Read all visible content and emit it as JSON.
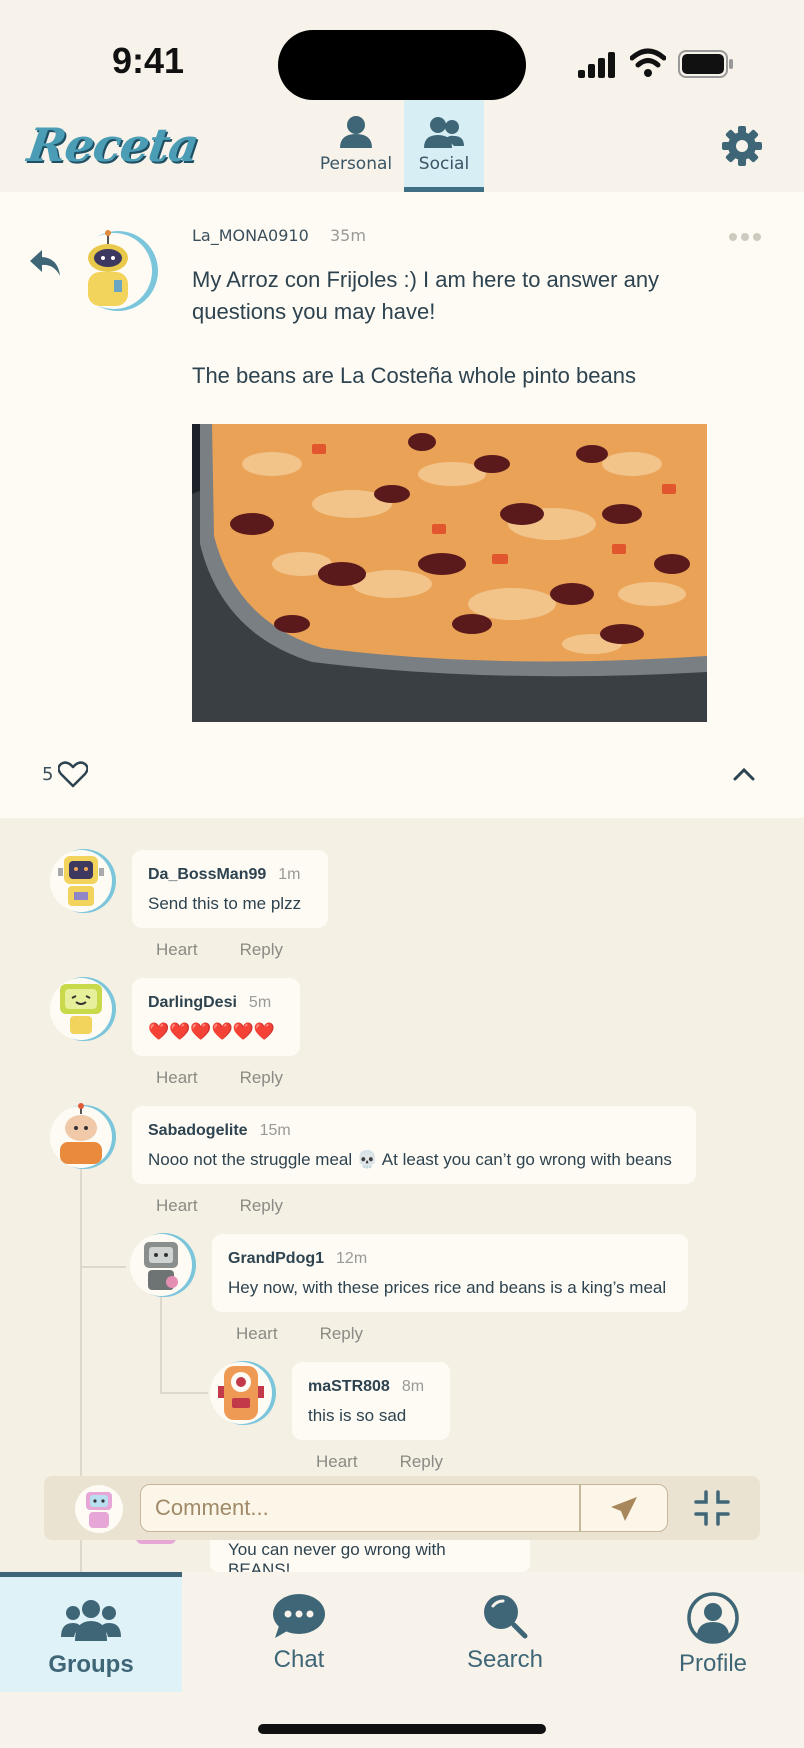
{
  "status_bar": {
    "time": "9:41"
  },
  "header": {
    "logo": "Receta",
    "tabs": [
      {
        "label": "Personal",
        "active": false
      },
      {
        "label": "Social",
        "active": true
      }
    ],
    "settings_icon": "gear-icon"
  },
  "post": {
    "username": "La_MONA0910",
    "time": "35m",
    "text": "My Arroz con Frijoles :) I am here to answer any questions you may have!",
    "text2": "The beans are La Costeña whole pinto beans",
    "likes": "5",
    "photo_alt": "rice and beans in a pan"
  },
  "comments": [
    {
      "username": "Da_BossMan99",
      "time": "1m",
      "text": "Send this to me plzz",
      "heart": "Heart",
      "reply": "Reply"
    },
    {
      "username": "DarlingDesi",
      "time": "5m",
      "text": "❤️❤️❤️❤️❤️❤️",
      "heart": "Heart",
      "reply": "Reply"
    },
    {
      "username": "Sabadogelite",
      "time": "15m",
      "text": "Nooo not the struggle meal 💀 At least you can’t go wrong with beans",
      "heart": "Heart",
      "reply": "Reply"
    },
    {
      "username": "GrandPdog1",
      "time": "12m",
      "text": "Hey now, with these prices rice and beans is a king’s meal",
      "heart": "Heart",
      "reply": "Reply"
    },
    {
      "username": "maSTR808",
      "time": "8m",
      "text": "this is so sad",
      "heart": "Heart",
      "reply": "Reply"
    },
    {
      "text": "You can never go wrong with BEANS!"
    }
  ],
  "comment_input": {
    "placeholder": "Comment..."
  },
  "bottom_nav": [
    {
      "label": "Groups",
      "active": true
    },
    {
      "label": "Chat",
      "active": false
    },
    {
      "label": "Search",
      "active": false
    },
    {
      "label": "Profile",
      "active": false
    }
  ],
  "colors": {
    "accent": "#3f6677",
    "active_tab_bg": "#dff2f8",
    "background": "#f5f0e4"
  }
}
